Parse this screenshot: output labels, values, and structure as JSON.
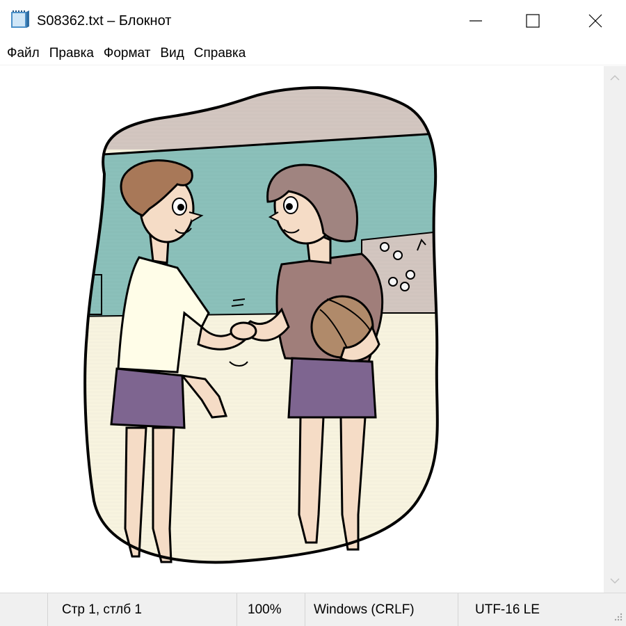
{
  "window": {
    "title": "S08362.txt – Блокнот",
    "icon": "notepad-icon",
    "controls": [
      "minimize-icon",
      "maximize-icon",
      "close-icon"
    ]
  },
  "menu": {
    "items": [
      {
        "label": "Файл"
      },
      {
        "label": "Правка"
      },
      {
        "label": "Формат"
      },
      {
        "label": "Вид"
      },
      {
        "label": "Справка"
      }
    ]
  },
  "editor": {
    "content_description_icon": "clipart-image",
    "colors": {
      "sky": "#8fc6c0",
      "cloud": "#d9ccc6",
      "ground": "#fffbe6",
      "skin": "#f5dcc6",
      "hair_left": "#a87858",
      "hair_right": "#a08480",
      "shirt_left": "#fffde8",
      "shirt_right": "#a07e7a",
      "shorts": "#7e6590",
      "ball": "#b08a6a"
    }
  },
  "statusbar": {
    "position": "Стр 1, стлб 1",
    "zoom": "100%",
    "line_ending": "Windows (CRLF)",
    "encoding": "UTF-16 LE"
  },
  "scrollbar": {
    "up_icon": "chevron-up-icon",
    "down_icon": "chevron-down-icon"
  }
}
